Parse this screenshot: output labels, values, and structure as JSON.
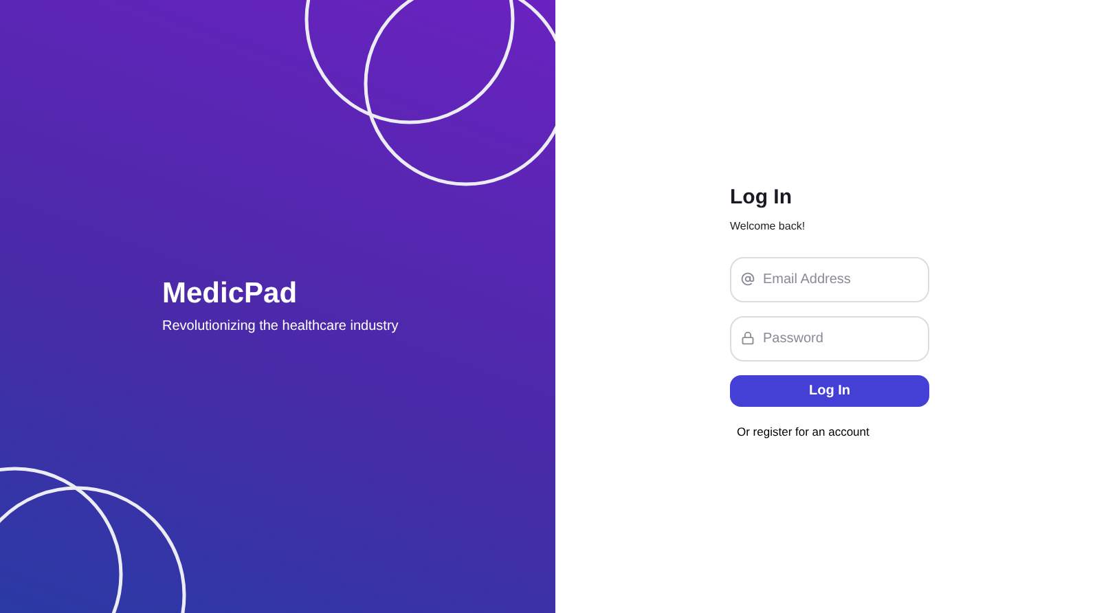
{
  "brand": {
    "name": "MedicPad",
    "tagline": "Revolutionizing the healthcare industry"
  },
  "login": {
    "title": "Log In",
    "subtitle": "Welcome back!",
    "fields": [
      {
        "kind": "email",
        "placeholder": "Email Address"
      },
      {
        "kind": "password",
        "placeholder": "Password"
      }
    ],
    "submit": "Log In",
    "register_link": "Or register for an account"
  }
}
